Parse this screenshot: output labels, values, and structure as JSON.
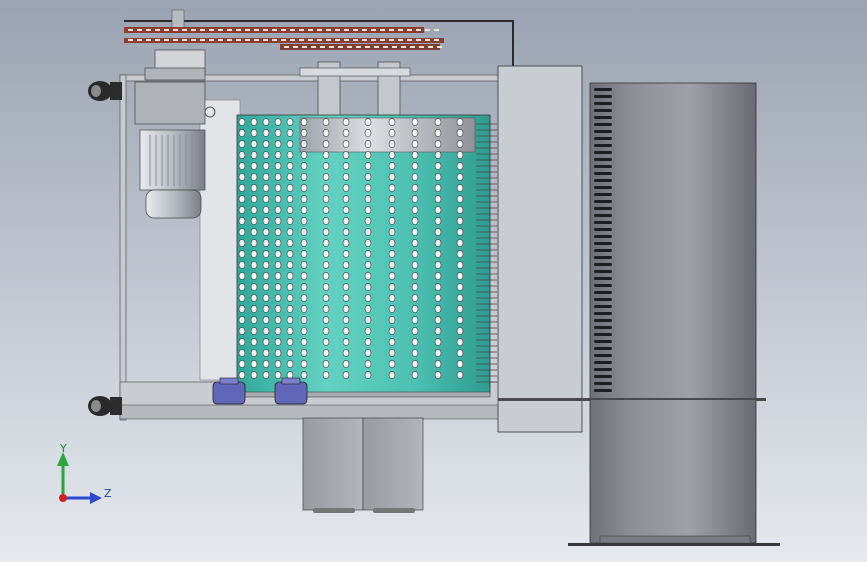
{
  "viewport": {
    "background_top": "#9aa3b2",
    "background_bottom": "#e6e9ee"
  },
  "triad": {
    "y_label": "Y",
    "z_label": "Z",
    "y_color": "#2aa63a",
    "z_color": "#2a4ad0",
    "origin_color": "#d02020"
  },
  "model": {
    "drum_color": "#48c4b4",
    "frame_color": "#b9bcc2",
    "bin_color": "#8c8c94",
    "motor_color": "#c9ccd2",
    "wheel_color": "#6066b8"
  }
}
